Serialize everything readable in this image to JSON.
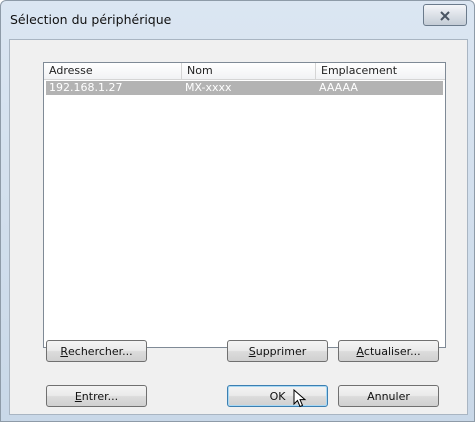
{
  "window": {
    "title": "Sélection du périphérique"
  },
  "list": {
    "columns": [
      "Adresse",
      "Nom",
      "Emplacement machine"
    ],
    "rows": [
      {
        "address": "192.168.1.27",
        "name": "MX-xxxx",
        "location": "AAAAA",
        "selected": true
      }
    ]
  },
  "buttons": {
    "search": {
      "mnemonic": "R",
      "rest": "echercher..."
    },
    "delete": {
      "mnemonic": "S",
      "rest": "upprimer"
    },
    "refresh": {
      "mnemonic": "A",
      "rest": "ctualiser..."
    },
    "enter": {
      "mnemonic": "E",
      "rest": "ntrer..."
    },
    "ok": "OK",
    "cancel": "Annuler"
  },
  "colors": {
    "selection": "#b3b3b3",
    "default_button_border": "#3c7fb1"
  }
}
